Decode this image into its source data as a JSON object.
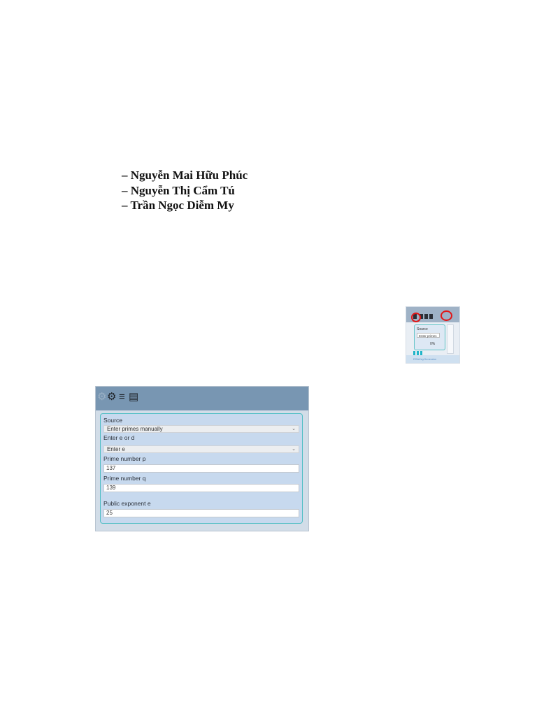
{
  "authors": [
    "– Nguyễn Mai Hữu Phúc",
    "– Nguyễn Thị Cẩm Tú",
    "– Trần Ngọc Diễm My"
  ],
  "thumbnail": {
    "source_label": "Source",
    "source_value": "Enter primes",
    "progress": "0%",
    "footer": "RSAKeyGenerator",
    "highlight_color": "#e01818"
  },
  "settings_panel": {
    "icons": [
      "gear-icon",
      "settings-icon",
      "list-icon",
      "clipboard-icon"
    ],
    "fields": {
      "source": {
        "label": "Source",
        "value": "Enter primes manually"
      },
      "e_or_d": {
        "label": "Enter e or d",
        "value": "Enter e"
      },
      "prime_p": {
        "label": "Prime number p",
        "value": "137"
      },
      "prime_q": {
        "label": "Prime number q",
        "value": "139"
      },
      "public_exponent": {
        "label": "Public exponent e",
        "value": "25"
      }
    },
    "border_color": "#4fbec4",
    "header_color": "#7896b2"
  }
}
